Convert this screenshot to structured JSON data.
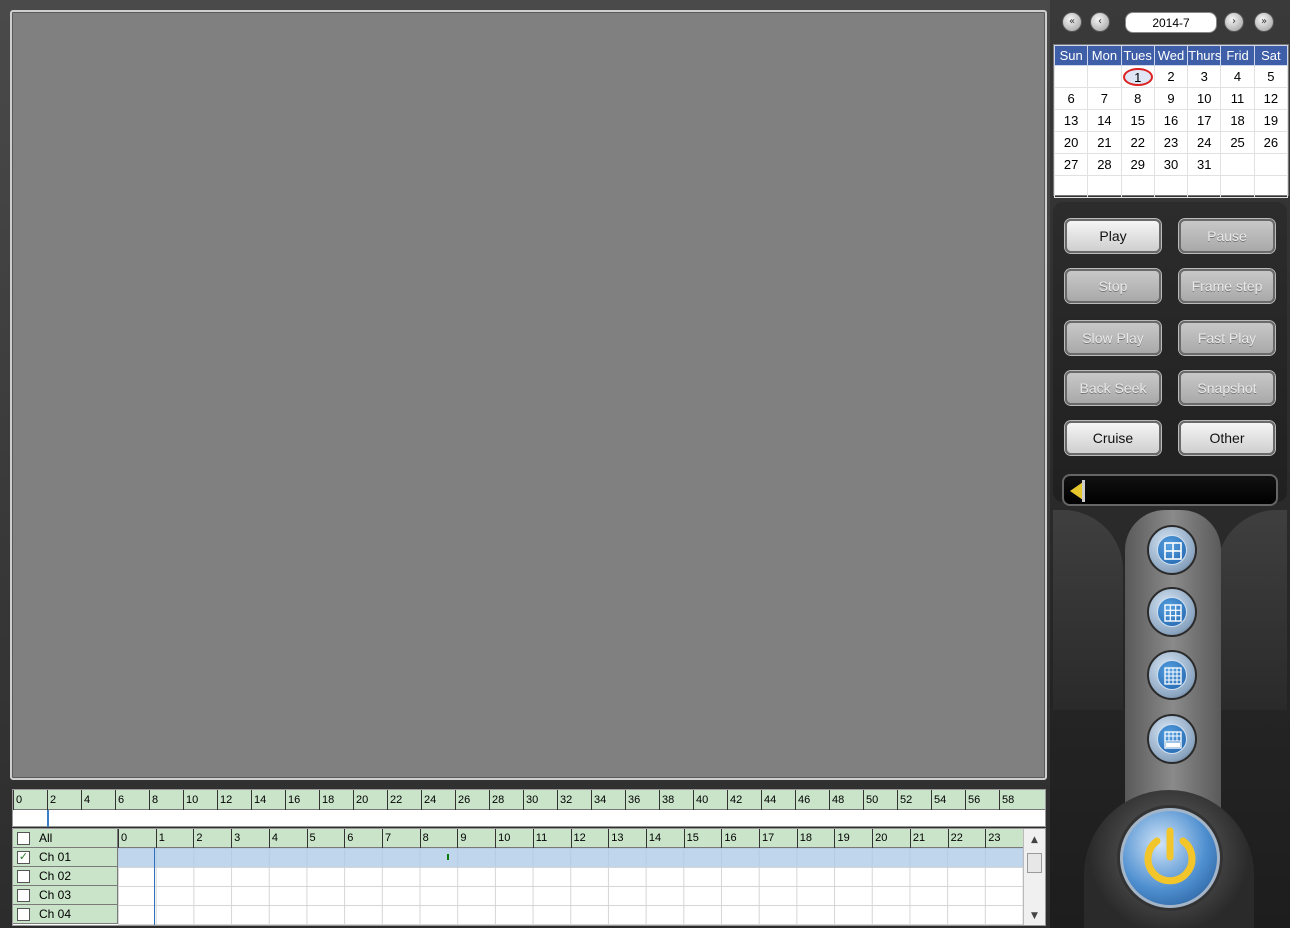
{
  "calendar": {
    "month_label": "2014-7",
    "nav": {
      "first": "«",
      "prev": "‹",
      "next": "›",
      "last": "»"
    },
    "weekdays": [
      "Sun",
      "Mon",
      "Tues",
      "Wed",
      "Thurs",
      "Frid",
      "Sat"
    ],
    "weeks": [
      [
        "",
        "",
        "1",
        "2",
        "3",
        "4",
        "5"
      ],
      [
        "6",
        "7",
        "8",
        "9",
        "10",
        "11",
        "12"
      ],
      [
        "13",
        "14",
        "15",
        "16",
        "17",
        "18",
        "19"
      ],
      [
        "20",
        "21",
        "22",
        "23",
        "24",
        "25",
        "26"
      ],
      [
        "27",
        "28",
        "29",
        "30",
        "31",
        "",
        ""
      ],
      [
        "",
        "",
        "",
        "",
        "",
        "",
        ""
      ]
    ],
    "selected_day": "1"
  },
  "playback": {
    "play": "Play",
    "pause": "Pause",
    "stop": "Stop",
    "frame_step": "Frame step",
    "slow_play": "Slow Play",
    "fast_play": "Fast Play",
    "back_seek": "Back Seek",
    "snapshot": "Snapshot",
    "cruise": "Cruise",
    "other": "Other"
  },
  "minute_ticks": [
    "0",
    "2",
    "4",
    "6",
    "8",
    "10",
    "12",
    "14",
    "16",
    "18",
    "20",
    "22",
    "24",
    "26",
    "28",
    "30",
    "32",
    "34",
    "36",
    "38",
    "40",
    "42",
    "44",
    "46",
    "48",
    "50",
    "52",
    "54",
    "56",
    "58"
  ],
  "hour_ticks": [
    "0",
    "1",
    "2",
    "3",
    "4",
    "5",
    "6",
    "7",
    "8",
    "9",
    "10",
    "11",
    "12",
    "13",
    "14",
    "15",
    "16",
    "17",
    "18",
    "19",
    "20",
    "21",
    "22",
    "23"
  ],
  "channels": {
    "all": {
      "label": "All",
      "checked": false
    },
    "list": [
      {
        "label": "Ch 01",
        "checked": true
      },
      {
        "label": "Ch 02",
        "checked": false
      },
      {
        "label": "Ch 03",
        "checked": false
      },
      {
        "label": "Ch 04",
        "checked": false
      }
    ]
  },
  "icons": {
    "layout_buttons": [
      "grid-2x2-icon",
      "grid-3x3-icon",
      "grid-4x4-icon",
      "grid-all-icon"
    ],
    "power": "power-icon",
    "volume": "speaker-icon"
  },
  "colors": {
    "accent_blue": "#3e5fa8",
    "timeline_green": "#c9e4c9",
    "today_ring": "#dd2222",
    "record_mark": "#0a7a0a"
  }
}
